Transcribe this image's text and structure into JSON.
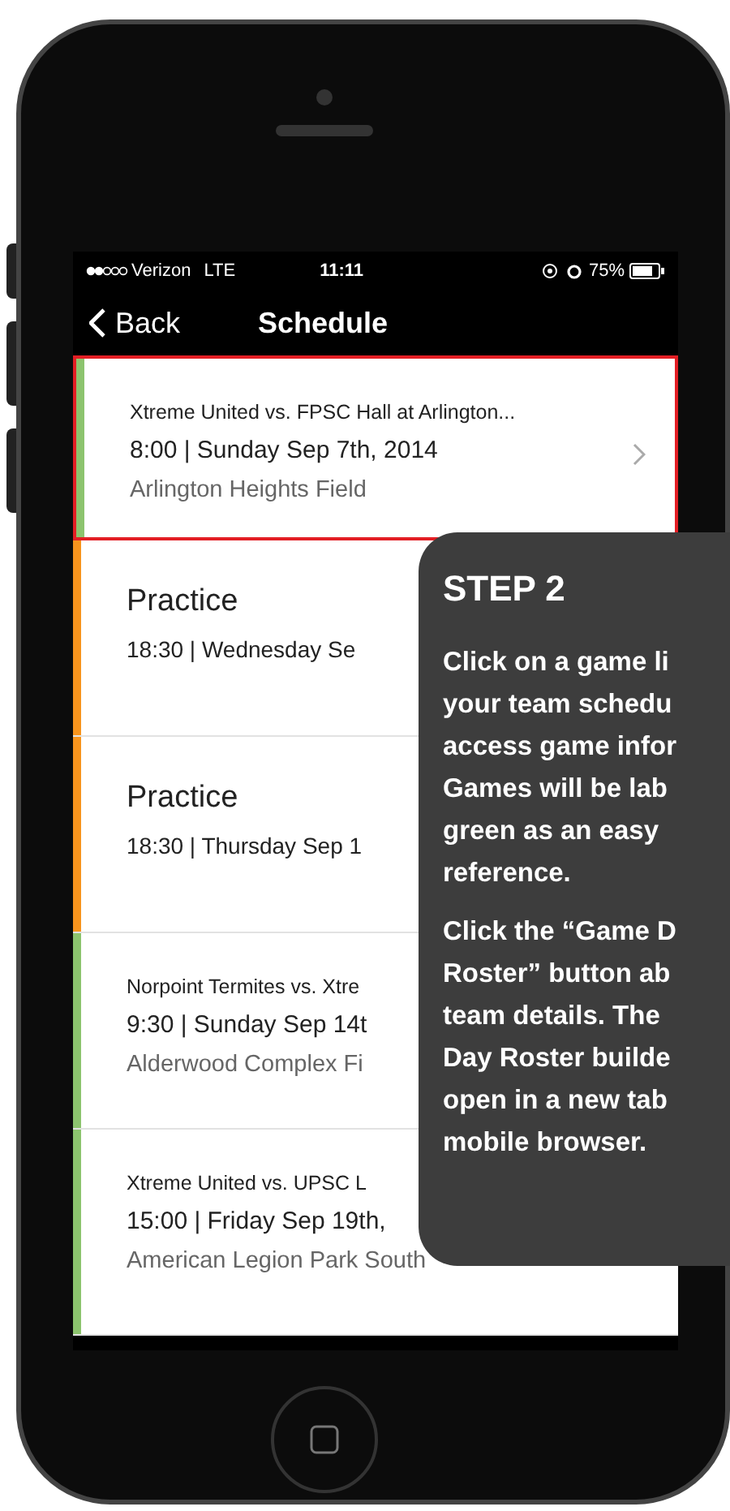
{
  "status_bar": {
    "carrier": "Verizon",
    "network": "LTE",
    "time": "11:11",
    "battery": "75%"
  },
  "nav": {
    "back": "Back",
    "title": "Schedule"
  },
  "events": [
    {
      "kind": "game",
      "selected": true,
      "color": "#8cc46e",
      "title": "Xtreme United vs. FPSC Hall  at Arlington...",
      "when": "8:00 | Sunday Sep 7th, 2014",
      "place": "Arlington Heights Field"
    },
    {
      "kind": "practice",
      "selected": false,
      "color": "#f7941d",
      "title": "Practice",
      "when": "18:30 | Wednesday Se"
    },
    {
      "kind": "practice",
      "selected": false,
      "color": "#f7941d",
      "title": "Practice",
      "when": "18:30 | Thursday Sep 1"
    },
    {
      "kind": "game",
      "selected": false,
      "color": "#8cc46e",
      "title": "Norpoint Termites vs. Xtre",
      "when": "9:30 | Sunday Sep 14t",
      "place": "Alderwood Complex Fi"
    },
    {
      "kind": "game",
      "selected": false,
      "color": "#8cc46e",
      "title": "Xtreme United vs. UPSC L",
      "when": "15:00 | Friday Sep 19th,",
      "place": "American Legion Park South"
    }
  ],
  "callout": {
    "title": "STEP 2",
    "paragraphs": [
      [
        "Click on a game li",
        "your team schedu",
        "access game infor",
        "Games will be lab",
        "green as an easy",
        "reference."
      ],
      [
        "Click the “Game D",
        "Roster” button ab",
        "team details. The",
        "Day Roster builde",
        "open in a new tab",
        "mobile browser."
      ]
    ]
  }
}
